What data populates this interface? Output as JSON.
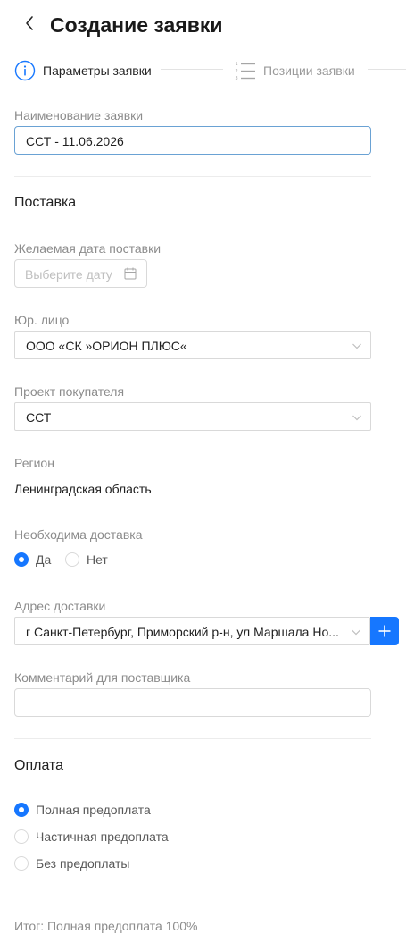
{
  "header": {
    "title": "Создание заявки"
  },
  "steps": [
    {
      "label": "Параметры заявки",
      "icon": "info-circle-icon"
    },
    {
      "label": "Позиции заявки",
      "icon": "ordered-list-icon"
    }
  ],
  "form": {
    "name": {
      "label": "Наименование заявки",
      "value": "ССТ - 11.06.2026"
    },
    "delivery_section": "Поставка",
    "desired_date": {
      "label": "Желаемая дата поставки",
      "placeholder": "Выберите дату"
    },
    "legal_entity": {
      "label": "Юр. лицо",
      "value": "ООО «СК »ОРИОН ПЛЮС«"
    },
    "buyer_project": {
      "label": "Проект покупателя",
      "value": "ССТ"
    },
    "region": {
      "label": "Регион",
      "value": "Ленинградская область"
    },
    "delivery_needed": {
      "label": "Необходима доставка",
      "options": [
        {
          "label": "Да",
          "checked": true
        },
        {
          "label": "Нет",
          "checked": false
        }
      ]
    },
    "delivery_address": {
      "label": "Адрес доставки",
      "value": "г Санкт-Петербург, Приморский р-н, ул Маршала Но..."
    },
    "supplier_comment": {
      "label": "Комментарий для поставщика",
      "value": ""
    },
    "payment_section": "Оплата",
    "payment": {
      "options": [
        {
          "label": "Полная предоплата",
          "checked": true
        },
        {
          "label": "Частичная предоплата",
          "checked": false
        },
        {
          "label": "Без предоплаты",
          "checked": false
        }
      ]
    },
    "total": "Итог: Полная предоплата 100%"
  },
  "colors": {
    "accent": "#1677ff",
    "focus_border": "#6aa2d4",
    "label_gray": "#8c8c8c"
  }
}
